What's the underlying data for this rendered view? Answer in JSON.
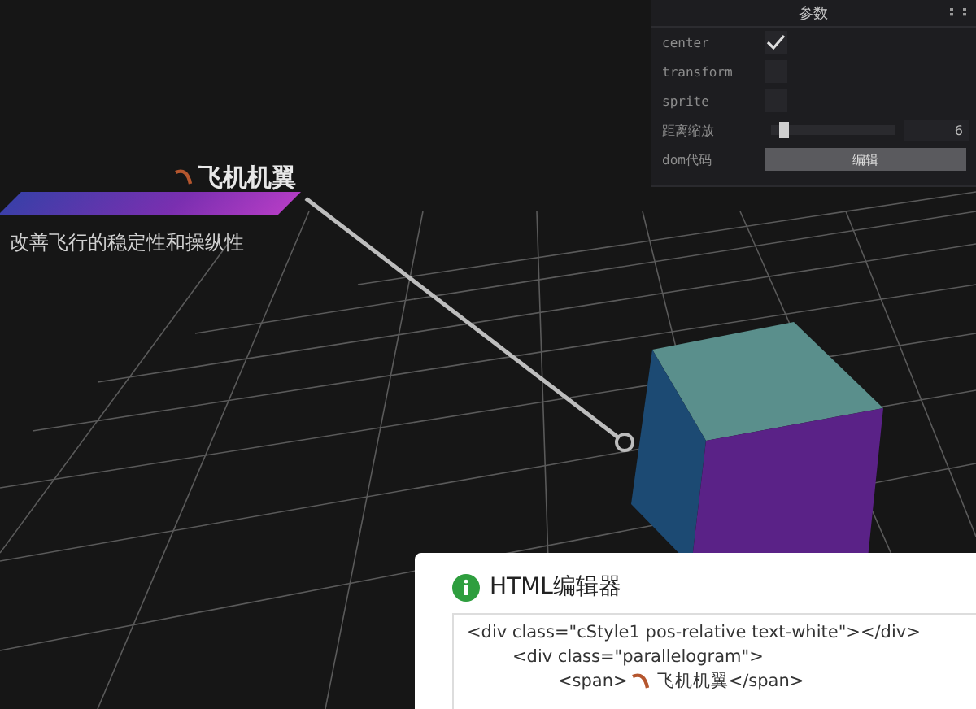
{
  "scene": {
    "label": {
      "title": "飞机机翼",
      "subtitle": "改善飞行的稳定性和操纵性"
    }
  },
  "panel": {
    "title": "参数",
    "rows": [
      {
        "kind": "checkbox",
        "label": "center",
        "checked": true
      },
      {
        "kind": "checkbox",
        "label": "transform",
        "checked": false
      },
      {
        "kind": "checkbox",
        "label": "sprite",
        "checked": false
      },
      {
        "kind": "slider",
        "label": "距离缩放",
        "level": 0.07,
        "value": "6"
      },
      {
        "kind": "button",
        "label": "dom代码",
        "button": "编辑"
      }
    ]
  },
  "dialog": {
    "title": "HTML编辑器",
    "code": [
      {
        "parts": [
          "<div class=\"cStyle1 pos-relative text-white\"></div>"
        ],
        "children": [
          {
            "parts": [
              "<div class=\"parallelogram\">"
            ],
            "children": [
              {
                "parts": [
                  "<span>",
                  "飞机机翼</span>"
                ]
              }
            ]
          }
        ]
      }
    ]
  }
}
